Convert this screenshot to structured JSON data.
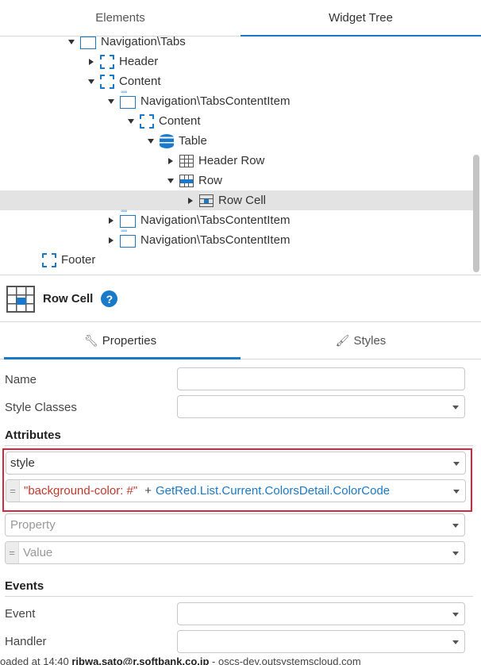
{
  "top_tabs": {
    "elements": "Elements",
    "widget_tree": "Widget Tree"
  },
  "tree": {
    "nodes": [
      {
        "label": "Navigation\\Tabs",
        "icon": "tabs-icon"
      },
      {
        "label": "Header",
        "icon": "container-icon"
      },
      {
        "label": "Content",
        "icon": "container-icon"
      },
      {
        "label": "Navigation\\TabsContentItem",
        "icon": "tabs-icon"
      },
      {
        "label": "Content",
        "icon": "container-icon"
      },
      {
        "label": "Table",
        "icon": "table-icon"
      },
      {
        "label": "Header Row",
        "icon": "header-row-icon"
      },
      {
        "label": "Row",
        "icon": "row-icon"
      },
      {
        "label": "Row Cell",
        "icon": "row-cell-icon",
        "selected": true
      },
      {
        "label": "Navigation\\TabsContentItem",
        "icon": "tabs-icon"
      },
      {
        "label": "Navigation\\TabsContentItem",
        "icon": "tabs-icon"
      },
      {
        "label": "Footer",
        "icon": "container-icon"
      }
    ]
  },
  "widget": {
    "title": "Row Cell",
    "help": "?"
  },
  "prop_tabs": {
    "properties": "Properties",
    "styles": "Styles"
  },
  "form": {
    "name_label": "Name",
    "name_value": "",
    "style_classes_label": "Style Classes",
    "style_classes_value": "",
    "attributes_heading": "Attributes",
    "attr_name": "style",
    "attr_eq": "=",
    "attr_value_string": "\"background-color: #\"",
    "attr_value_op": "+",
    "attr_value_expr": "GetRed.List.Current.ColorsDetail.ColorCode",
    "new_property_placeholder": "Property",
    "new_value_eq": "=",
    "new_value_placeholder": "Value",
    "events_heading": "Events",
    "event_label": "Event",
    "handler_label": "Handler"
  },
  "status_bar": {
    "prefix": "oaded at 14:40",
    "user": "ribwa.sato@r.softbank.co.jp",
    "server": "- oscs-dev.outsystemscloud.com"
  },
  "colors": {
    "accent": "#1a79c8",
    "highlight": "#d7263d",
    "selected_row": "#e3e3e3"
  }
}
